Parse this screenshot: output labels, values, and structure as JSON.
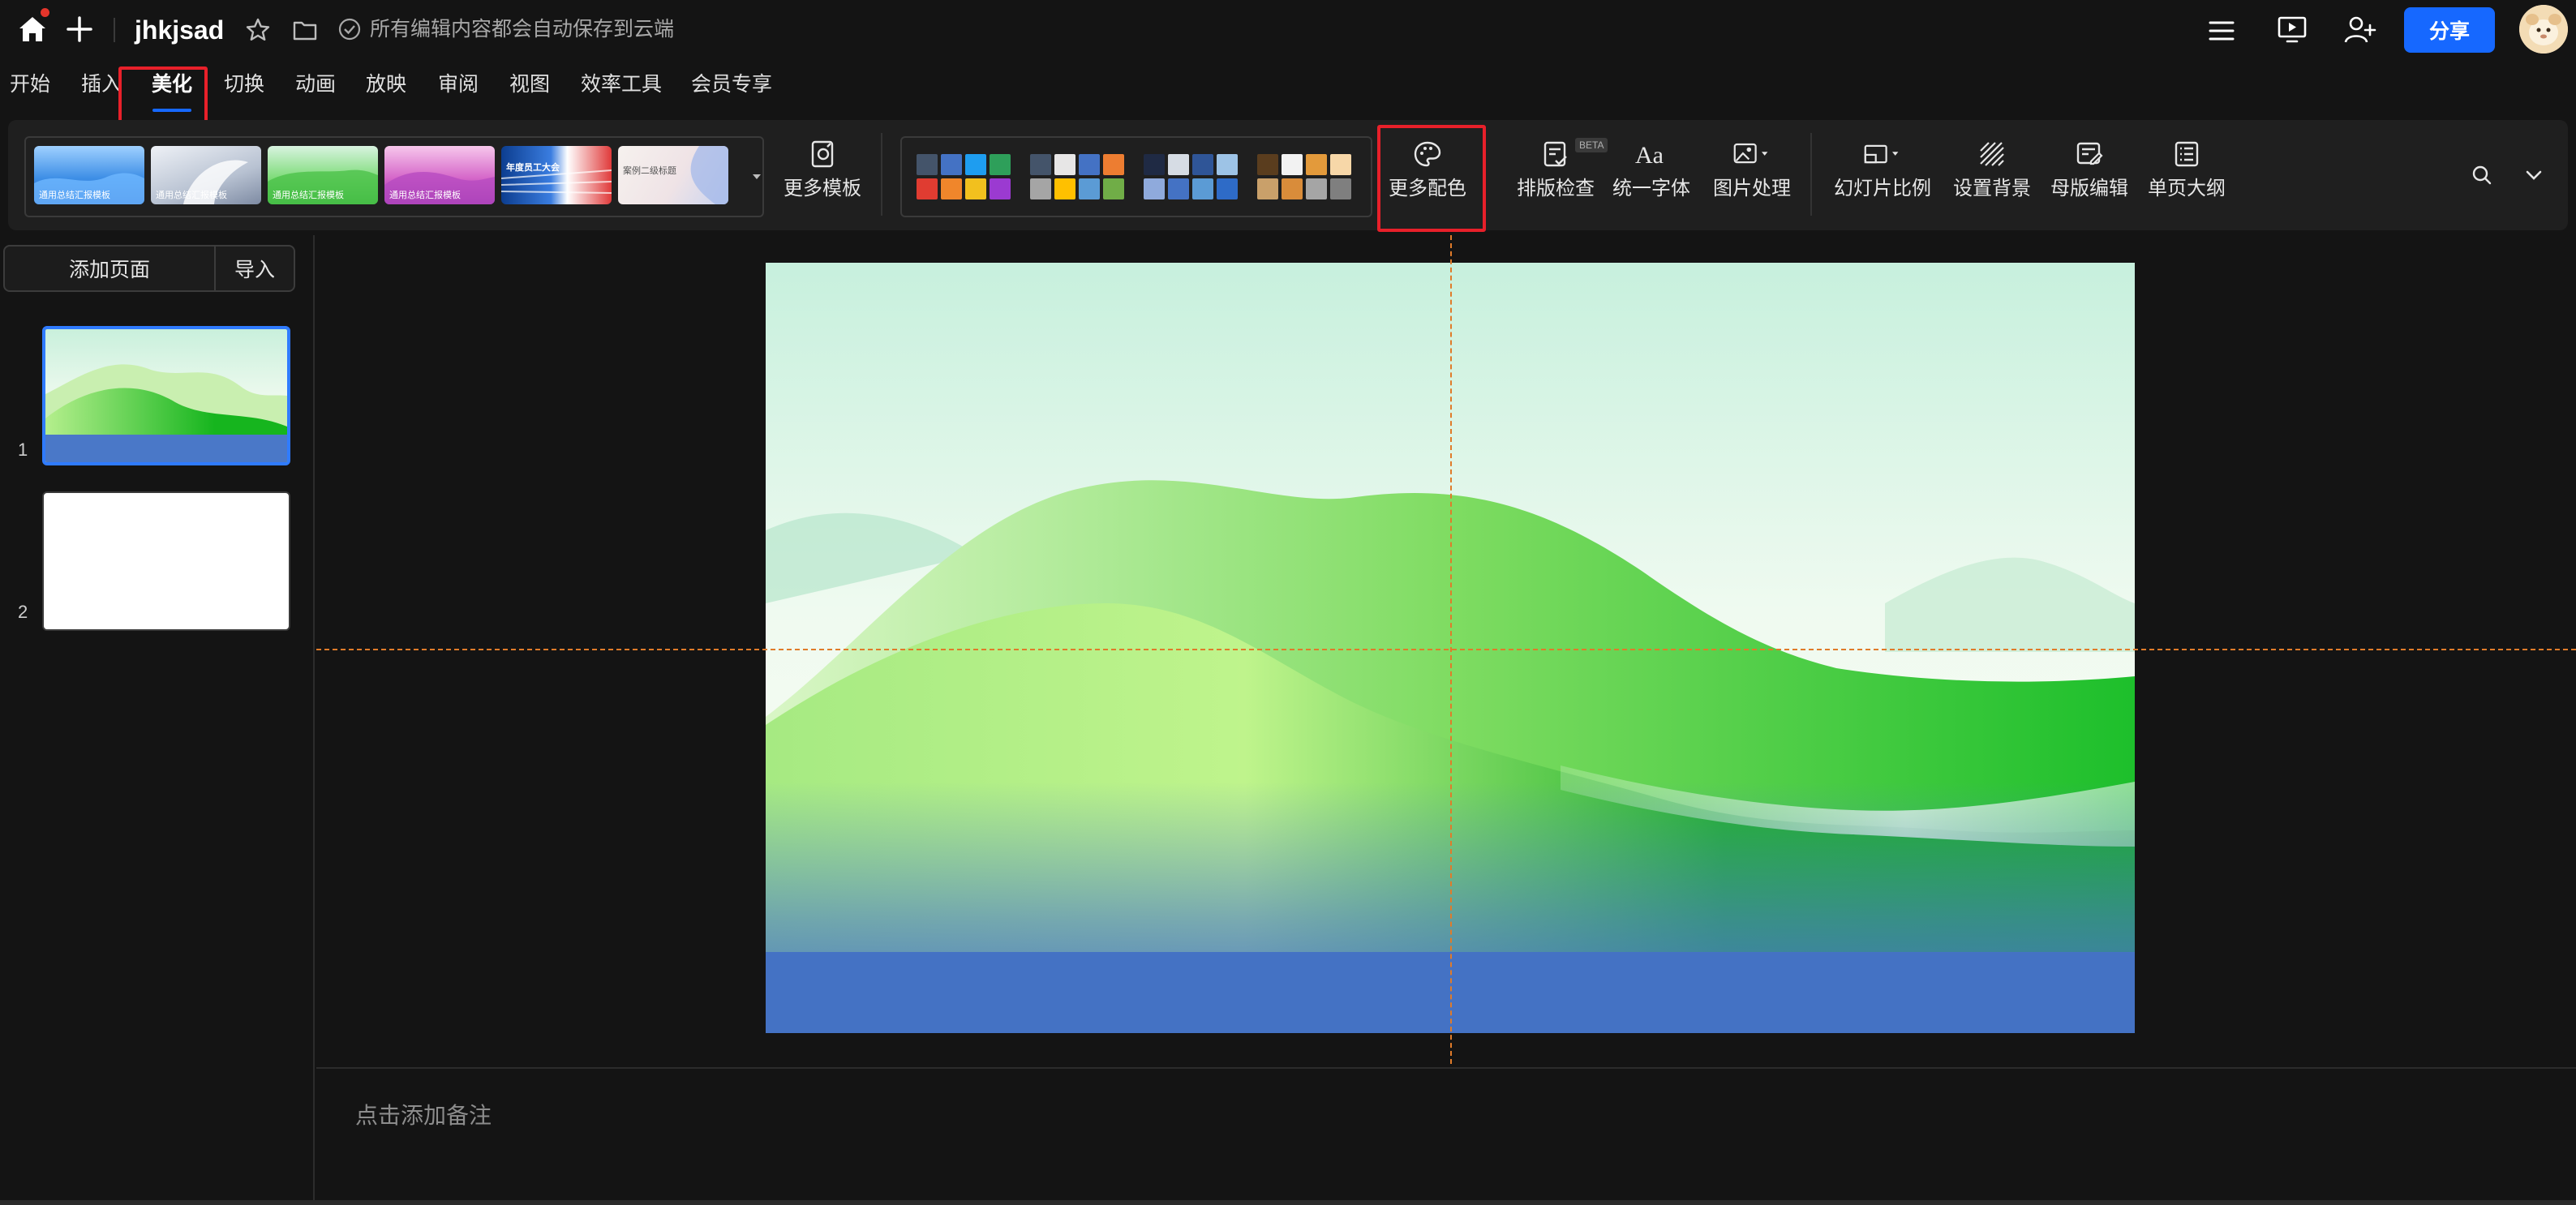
{
  "app": {
    "doc_title": "jhkjsad",
    "save_status": "所有编辑内容都会自动保存到云端",
    "share_label": "分享",
    "icons": [
      "home-icon",
      "plus-icon",
      "star-icon",
      "folder-icon",
      "check-circle-icon",
      "menu-icon",
      "present-icon",
      "add-user-icon",
      "avatar"
    ]
  },
  "menu": {
    "tabs": [
      {
        "label": "开始"
      },
      {
        "label": "插入"
      },
      {
        "label": "美化",
        "active": true
      },
      {
        "label": "切换"
      },
      {
        "label": "动画"
      },
      {
        "label": "放映"
      },
      {
        "label": "审阅"
      },
      {
        "label": "视图"
      },
      {
        "label": "效率工具"
      },
      {
        "label": "会员专享"
      }
    ]
  },
  "ribbon": {
    "templates": [
      {
        "caption": "通用总结汇报模板"
      },
      {
        "caption": "通用总结汇报模板"
      },
      {
        "caption": "通用总结汇报模板"
      },
      {
        "caption": "通用总结汇报模板"
      },
      {
        "caption": "年度员工大会"
      },
      {
        "caption": "案例二级标题"
      }
    ],
    "more_templates": "更多模板",
    "color_schemes": [
      [
        "#44546a",
        "#4472c4",
        "#1e9df0",
        "#2e9f5a",
        "#e03c31",
        "#f0862b",
        "#f2c01e",
        "#9b3ad1"
      ],
      [
        "#44546a",
        "#e7e6e6",
        "#4472c4",
        "#ed7d31",
        "#a5a5a5",
        "#ffc000",
        "#5b9bd5",
        "#70ad47"
      ],
      [
        "#1f2a44",
        "#d6dce4",
        "#2f5597",
        "#9dc3e6",
        "#8faadc",
        "#4472c4",
        "#5b9bd5",
        "#2e6bc7"
      ],
      [
        "#5a3d1e",
        "#f2f2f2",
        "#e39a3b",
        "#f7d7a8",
        "#c9a06a",
        "#d98c3a",
        "#a5a5a5",
        "#7f7f7f"
      ]
    ],
    "more_colors": "更多配色",
    "layout_check": "排版检查",
    "beta": "BETA",
    "unify_font": "统一字体",
    "image_process": "图片处理",
    "slide_ratio": "幻灯片比例",
    "set_background": "设置背景",
    "master_edit": "母版编辑",
    "outline": "单页大纲"
  },
  "sidebar": {
    "add_page": "添加页面",
    "import": "导入",
    "slides": [
      {
        "number": "1",
        "selected": true
      },
      {
        "number": "2",
        "selected": false
      }
    ]
  },
  "notes": {
    "placeholder": "点击添加备注"
  },
  "colors": {
    "accent": "#1668ff",
    "highlight": "#e8202a",
    "guide": "#e07b2a",
    "background": "#141414",
    "ribbon": "#1f1f1f"
  }
}
